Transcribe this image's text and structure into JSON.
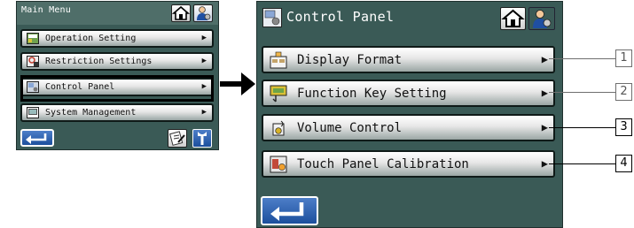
{
  "left_panel": {
    "title": "Main Menu",
    "items": [
      {
        "label": "Operation Setting",
        "icon": "operation-setting-icon"
      },
      {
        "label": "Restriction Settings",
        "icon": "restriction-settings-icon"
      },
      {
        "label": "Control Panel",
        "icon": "control-panel-icon"
      },
      {
        "label": "System Management",
        "icon": "system-management-icon"
      }
    ]
  },
  "right_panel": {
    "title": "Control Panel",
    "items": [
      {
        "label": "Display Format",
        "icon": "display-format-icon"
      },
      {
        "label": "Function Key Setting",
        "icon": "function-key-icon"
      },
      {
        "label": "Volume Control",
        "icon": "volume-control-icon"
      },
      {
        "label": "Touch Panel Calibration",
        "icon": "touch-calibration-icon"
      }
    ]
  },
  "callouts": [
    "1",
    "2",
    "3",
    "4"
  ],
  "colors": {
    "panel_bg": "#3a5a56",
    "back_button": "#1c4f9d",
    "button_face": "#e6e6e6"
  }
}
